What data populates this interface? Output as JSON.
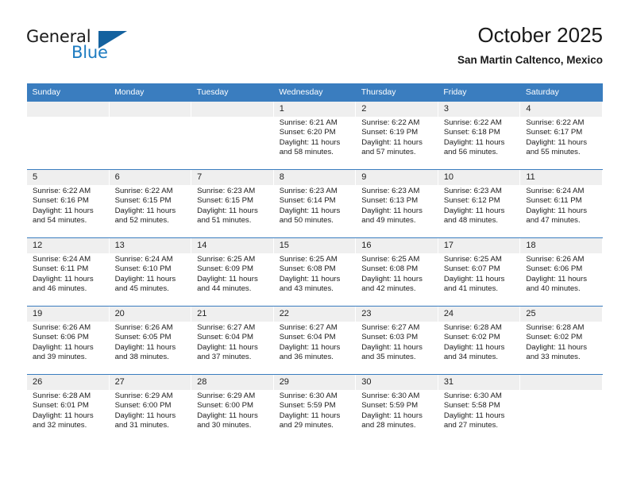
{
  "brand": {
    "name_top": "General",
    "name_bottom": "Blue"
  },
  "header": {
    "title": "October 2025",
    "subtitle": "San Martin Caltenco, Mexico"
  },
  "colors": {
    "header_blue": "#3a7dbf",
    "brand_blue": "#1c7bc0",
    "day_strip": "#efefef",
    "text": "#1a1a1a"
  },
  "calendar": {
    "weekdays": [
      "Sunday",
      "Monday",
      "Tuesday",
      "Wednesday",
      "Thursday",
      "Friday",
      "Saturday"
    ],
    "labels": {
      "sunrise": "Sunrise:",
      "sunset": "Sunset:",
      "daylight": "Daylight:"
    },
    "weeks": [
      [
        {
          "day": "",
          "sunrise": "",
          "sunset": "",
          "daylight_1": "",
          "daylight_2": ""
        },
        {
          "day": "",
          "sunrise": "",
          "sunset": "",
          "daylight_1": "",
          "daylight_2": ""
        },
        {
          "day": "",
          "sunrise": "",
          "sunset": "",
          "daylight_1": "",
          "daylight_2": ""
        },
        {
          "day": "1",
          "sunrise": "Sunrise: 6:21 AM",
          "sunset": "Sunset: 6:20 PM",
          "daylight_1": "Daylight: 11 hours",
          "daylight_2": "and 58 minutes."
        },
        {
          "day": "2",
          "sunrise": "Sunrise: 6:22 AM",
          "sunset": "Sunset: 6:19 PM",
          "daylight_1": "Daylight: 11 hours",
          "daylight_2": "and 57 minutes."
        },
        {
          "day": "3",
          "sunrise": "Sunrise: 6:22 AM",
          "sunset": "Sunset: 6:18 PM",
          "daylight_1": "Daylight: 11 hours",
          "daylight_2": "and 56 minutes."
        },
        {
          "day": "4",
          "sunrise": "Sunrise: 6:22 AM",
          "sunset": "Sunset: 6:17 PM",
          "daylight_1": "Daylight: 11 hours",
          "daylight_2": "and 55 minutes."
        }
      ],
      [
        {
          "day": "5",
          "sunrise": "Sunrise: 6:22 AM",
          "sunset": "Sunset: 6:16 PM",
          "daylight_1": "Daylight: 11 hours",
          "daylight_2": "and 54 minutes."
        },
        {
          "day": "6",
          "sunrise": "Sunrise: 6:22 AM",
          "sunset": "Sunset: 6:15 PM",
          "daylight_1": "Daylight: 11 hours",
          "daylight_2": "and 52 minutes."
        },
        {
          "day": "7",
          "sunrise": "Sunrise: 6:23 AM",
          "sunset": "Sunset: 6:15 PM",
          "daylight_1": "Daylight: 11 hours",
          "daylight_2": "and 51 minutes."
        },
        {
          "day": "8",
          "sunrise": "Sunrise: 6:23 AM",
          "sunset": "Sunset: 6:14 PM",
          "daylight_1": "Daylight: 11 hours",
          "daylight_2": "and 50 minutes."
        },
        {
          "day": "9",
          "sunrise": "Sunrise: 6:23 AM",
          "sunset": "Sunset: 6:13 PM",
          "daylight_1": "Daylight: 11 hours",
          "daylight_2": "and 49 minutes."
        },
        {
          "day": "10",
          "sunrise": "Sunrise: 6:23 AM",
          "sunset": "Sunset: 6:12 PM",
          "daylight_1": "Daylight: 11 hours",
          "daylight_2": "and 48 minutes."
        },
        {
          "day": "11",
          "sunrise": "Sunrise: 6:24 AM",
          "sunset": "Sunset: 6:11 PM",
          "daylight_1": "Daylight: 11 hours",
          "daylight_2": "and 47 minutes."
        }
      ],
      [
        {
          "day": "12",
          "sunrise": "Sunrise: 6:24 AM",
          "sunset": "Sunset: 6:11 PM",
          "daylight_1": "Daylight: 11 hours",
          "daylight_2": "and 46 minutes."
        },
        {
          "day": "13",
          "sunrise": "Sunrise: 6:24 AM",
          "sunset": "Sunset: 6:10 PM",
          "daylight_1": "Daylight: 11 hours",
          "daylight_2": "and 45 minutes."
        },
        {
          "day": "14",
          "sunrise": "Sunrise: 6:25 AM",
          "sunset": "Sunset: 6:09 PM",
          "daylight_1": "Daylight: 11 hours",
          "daylight_2": "and 44 minutes."
        },
        {
          "day": "15",
          "sunrise": "Sunrise: 6:25 AM",
          "sunset": "Sunset: 6:08 PM",
          "daylight_1": "Daylight: 11 hours",
          "daylight_2": "and 43 minutes."
        },
        {
          "day": "16",
          "sunrise": "Sunrise: 6:25 AM",
          "sunset": "Sunset: 6:08 PM",
          "daylight_1": "Daylight: 11 hours",
          "daylight_2": "and 42 minutes."
        },
        {
          "day": "17",
          "sunrise": "Sunrise: 6:25 AM",
          "sunset": "Sunset: 6:07 PM",
          "daylight_1": "Daylight: 11 hours",
          "daylight_2": "and 41 minutes."
        },
        {
          "day": "18",
          "sunrise": "Sunrise: 6:26 AM",
          "sunset": "Sunset: 6:06 PM",
          "daylight_1": "Daylight: 11 hours",
          "daylight_2": "and 40 minutes."
        }
      ],
      [
        {
          "day": "19",
          "sunrise": "Sunrise: 6:26 AM",
          "sunset": "Sunset: 6:06 PM",
          "daylight_1": "Daylight: 11 hours",
          "daylight_2": "and 39 minutes."
        },
        {
          "day": "20",
          "sunrise": "Sunrise: 6:26 AM",
          "sunset": "Sunset: 6:05 PM",
          "daylight_1": "Daylight: 11 hours",
          "daylight_2": "and 38 minutes."
        },
        {
          "day": "21",
          "sunrise": "Sunrise: 6:27 AM",
          "sunset": "Sunset: 6:04 PM",
          "daylight_1": "Daylight: 11 hours",
          "daylight_2": "and 37 minutes."
        },
        {
          "day": "22",
          "sunrise": "Sunrise: 6:27 AM",
          "sunset": "Sunset: 6:04 PM",
          "daylight_1": "Daylight: 11 hours",
          "daylight_2": "and 36 minutes."
        },
        {
          "day": "23",
          "sunrise": "Sunrise: 6:27 AM",
          "sunset": "Sunset: 6:03 PM",
          "daylight_1": "Daylight: 11 hours",
          "daylight_2": "and 35 minutes."
        },
        {
          "day": "24",
          "sunrise": "Sunrise: 6:28 AM",
          "sunset": "Sunset: 6:02 PM",
          "daylight_1": "Daylight: 11 hours",
          "daylight_2": "and 34 minutes."
        },
        {
          "day": "25",
          "sunrise": "Sunrise: 6:28 AM",
          "sunset": "Sunset: 6:02 PM",
          "daylight_1": "Daylight: 11 hours",
          "daylight_2": "and 33 minutes."
        }
      ],
      [
        {
          "day": "26",
          "sunrise": "Sunrise: 6:28 AM",
          "sunset": "Sunset: 6:01 PM",
          "daylight_1": "Daylight: 11 hours",
          "daylight_2": "and 32 minutes."
        },
        {
          "day": "27",
          "sunrise": "Sunrise: 6:29 AM",
          "sunset": "Sunset: 6:00 PM",
          "daylight_1": "Daylight: 11 hours",
          "daylight_2": "and 31 minutes."
        },
        {
          "day": "28",
          "sunrise": "Sunrise: 6:29 AM",
          "sunset": "Sunset: 6:00 PM",
          "daylight_1": "Daylight: 11 hours",
          "daylight_2": "and 30 minutes."
        },
        {
          "day": "29",
          "sunrise": "Sunrise: 6:30 AM",
          "sunset": "Sunset: 5:59 PM",
          "daylight_1": "Daylight: 11 hours",
          "daylight_2": "and 29 minutes."
        },
        {
          "day": "30",
          "sunrise": "Sunrise: 6:30 AM",
          "sunset": "Sunset: 5:59 PM",
          "daylight_1": "Daylight: 11 hours",
          "daylight_2": "and 28 minutes."
        },
        {
          "day": "31",
          "sunrise": "Sunrise: 6:30 AM",
          "sunset": "Sunset: 5:58 PM",
          "daylight_1": "Daylight: 11 hours",
          "daylight_2": "and 27 minutes."
        },
        {
          "day": "",
          "sunrise": "",
          "sunset": "",
          "daylight_1": "",
          "daylight_2": ""
        }
      ]
    ]
  }
}
